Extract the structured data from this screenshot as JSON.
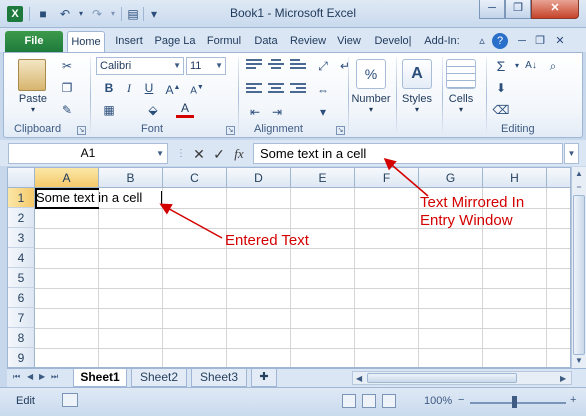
{
  "window": {
    "title": "Book1  -  Microsoft Excel",
    "app_icon_letter": "X",
    "controls": {
      "minimize": "─",
      "restore": "❐",
      "close": "✕"
    },
    "ribbon_controls": {
      "minimize": "─",
      "restore": "❐",
      "close": "✕"
    }
  },
  "qat": {
    "save_icon": "■",
    "undo_icon": "↶",
    "redo_icon": "↷",
    "print_icon": "▤",
    "customize_icon": "▾"
  },
  "tabs": {
    "file": "File",
    "items": [
      "Home",
      "Insert",
      "Page La",
      "Formul",
      "Data",
      "Review",
      "View",
      "Develo|",
      "Add-In:"
    ],
    "active": "Home"
  },
  "ribbon": {
    "clipboard": {
      "label": "Clipboard",
      "paste": "Paste"
    },
    "font": {
      "label": "Font",
      "name": "Calibri",
      "size": "11",
      "bold": "B",
      "italic": "I",
      "underline": "U",
      "font_color": "A"
    },
    "alignment": {
      "label": "Alignment"
    },
    "number": {
      "label": "Number",
      "icon": "%"
    },
    "styles": {
      "label": "Styles",
      "icon": "A"
    },
    "cells": {
      "label": "Cells"
    },
    "editing": {
      "label": "Editing",
      "sum": "Σ",
      "sort": "A↓",
      "find": "⌕"
    }
  },
  "formula_bar": {
    "name_box": "A1",
    "cancel": "✕",
    "enter": "✓",
    "fx": "fx",
    "content": "Some text in a cell"
  },
  "grid": {
    "columns": [
      "A",
      "B",
      "C",
      "D",
      "E",
      "F",
      "G",
      "H"
    ],
    "rows": [
      "1",
      "2",
      "3",
      "4",
      "5",
      "6",
      "7",
      "8",
      "9"
    ],
    "selected_column": "A",
    "selected_row": "1",
    "a1_value": "Some text in a cell"
  },
  "annotations": {
    "entered_text": "Entered Text",
    "mirrored_line1": "Text Mirrored In",
    "mirrored_line2": "Entry Window",
    "color": "#d40000"
  },
  "sheets": {
    "tabs": [
      "Sheet1",
      "Sheet2",
      "Sheet3"
    ],
    "active": "Sheet1",
    "nav": [
      "⏮",
      "◀",
      "▶",
      "⏭"
    ]
  },
  "status": {
    "mode": "Edit",
    "zoom": "100%",
    "zoom_minus": "−",
    "zoom_plus": "+"
  },
  "colors": {
    "file_tab": "#1d7a3c",
    "selection_header": "#f5c96a",
    "annotation": "#d40000"
  }
}
